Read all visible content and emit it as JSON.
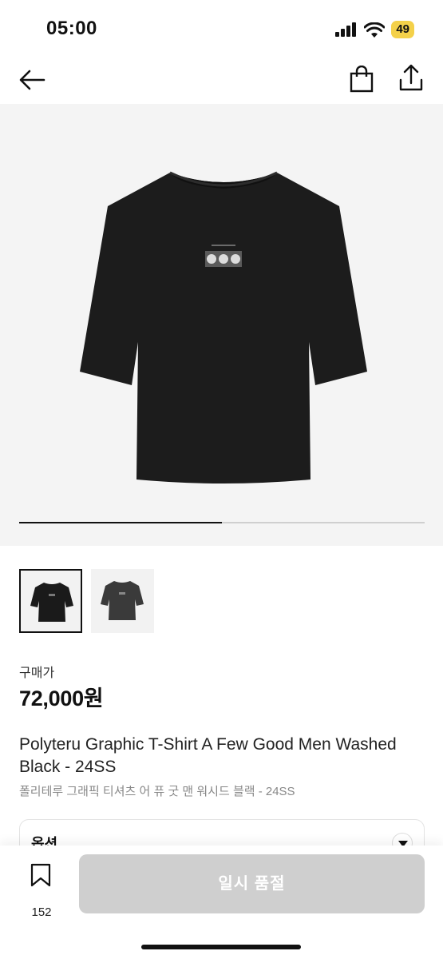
{
  "status_bar": {
    "time": "05:00",
    "battery": "49",
    "icons": [
      "signal-icon",
      "wifi-icon",
      "battery-icon"
    ]
  },
  "nav": {
    "icons": [
      "back-arrow-icon",
      "shopping-bag-icon",
      "share-icon"
    ]
  },
  "gallery": {
    "progress": 0.5,
    "thumbnails": [
      {
        "name": "black-shirt-thumbnail",
        "color": "#1a1a1a",
        "selected": true
      },
      {
        "name": "gray-shirt-thumbnail",
        "color": "#3a3a3a",
        "selected": false
      }
    ]
  },
  "product": {
    "price_label": "구매가",
    "price": "72,000원",
    "title_en": "Polyteru Graphic T-Shirt A Few Good Men Washed Black - 24SS",
    "title_ko": "폴리테루 그래픽 티셔츠 어 퓨 굿 맨 워시드 블랙 - 24SS"
  },
  "option": {
    "label": "옵션"
  },
  "bottom_bar": {
    "wishlist_count": "152",
    "button_label": "일시 품절"
  },
  "colors": {
    "shirt": "#1c1c1c",
    "hero_bg": "#f4f4f4",
    "battery": "#f4d14a",
    "disabled_button": "#cfcfcf"
  }
}
